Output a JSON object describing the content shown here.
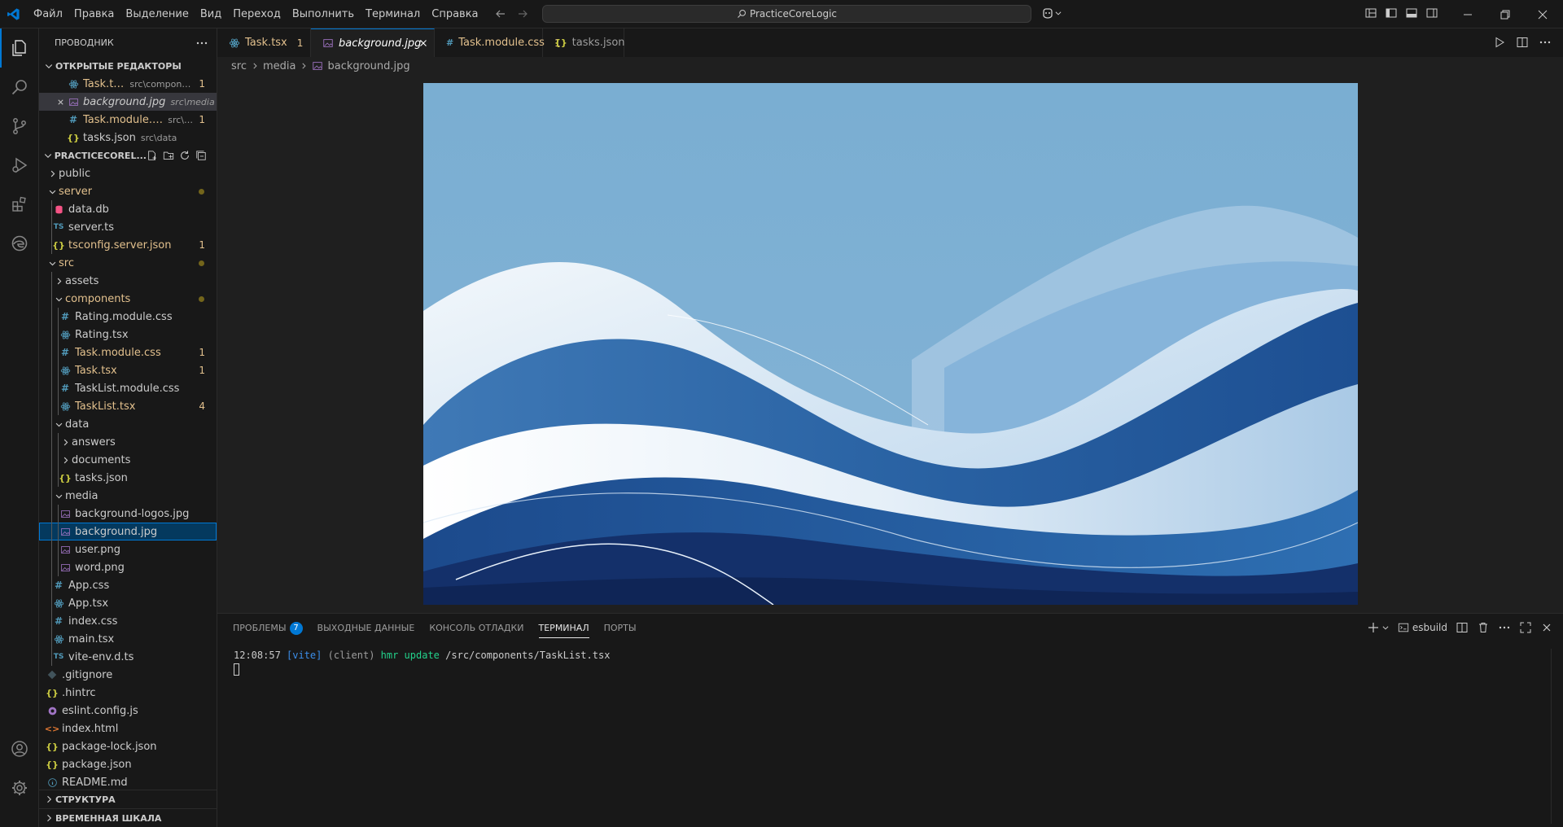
{
  "menu": [
    "Файл",
    "Правка",
    "Выделение",
    "Вид",
    "Переход",
    "Выполнить",
    "Терминал",
    "Справка"
  ],
  "command_center": "PracticeCoreLogic",
  "explorer": {
    "title": "ПРОВОДНИК",
    "open_editors_header": "ОТКРЫТЫЕ РЕДАКТОРЫ",
    "open_editors": [
      {
        "name": "Task.tsx",
        "path": "src\\compone...",
        "badge": "1",
        "icon": "react-icon"
      },
      {
        "name": "background.jpg",
        "path": "src\\media",
        "badge": "",
        "icon": "image-icon"
      },
      {
        "name": "Task.module.css",
        "path": "src\\c...",
        "badge": "1",
        "icon": "css-icon"
      },
      {
        "name": "tasks.json",
        "path": "src\\data",
        "badge": "",
        "icon": "json-icon"
      }
    ],
    "project_header": "PRACTICECOREL...",
    "tree": [
      {
        "name": "public",
        "type": "folder",
        "depth": 0,
        "expanded": false
      },
      {
        "name": "server",
        "type": "folder",
        "depth": 0,
        "expanded": true,
        "modified": true,
        "dot": true
      },
      {
        "name": "data.db",
        "type": "file",
        "depth": 1,
        "icon": "database-icon"
      },
      {
        "name": "server.ts",
        "type": "file",
        "depth": 1,
        "icon": "ts-icon"
      },
      {
        "name": "tsconfig.server.json",
        "type": "file",
        "depth": 1,
        "icon": "json-icon",
        "modified": true,
        "badge": "1"
      },
      {
        "name": "src",
        "type": "folder",
        "depth": 0,
        "expanded": true,
        "modified": true,
        "dot": true
      },
      {
        "name": "assets",
        "type": "folder",
        "depth": 1,
        "expanded": false
      },
      {
        "name": "components",
        "type": "folder",
        "depth": 1,
        "expanded": true,
        "modified": true,
        "dot": true
      },
      {
        "name": "Rating.module.css",
        "type": "file",
        "depth": 2,
        "icon": "css-icon"
      },
      {
        "name": "Rating.tsx",
        "type": "file",
        "depth": 2,
        "icon": "react-icon"
      },
      {
        "name": "Task.module.css",
        "type": "file",
        "depth": 2,
        "icon": "css-icon",
        "modified": true,
        "badge": "1"
      },
      {
        "name": "Task.tsx",
        "type": "file",
        "depth": 2,
        "icon": "react-icon",
        "modified": true,
        "badge": "1"
      },
      {
        "name": "TaskList.module.css",
        "type": "file",
        "depth": 2,
        "icon": "css-icon"
      },
      {
        "name": "TaskList.tsx",
        "type": "file",
        "depth": 2,
        "icon": "react-icon",
        "modified": true,
        "badge": "4"
      },
      {
        "name": "data",
        "type": "folder",
        "depth": 1,
        "expanded": true
      },
      {
        "name": "answers",
        "type": "folder",
        "depth": 2,
        "expanded": false
      },
      {
        "name": "documents",
        "type": "folder",
        "depth": 2,
        "expanded": false
      },
      {
        "name": "tasks.json",
        "type": "file",
        "depth": 2,
        "icon": "json-icon"
      },
      {
        "name": "media",
        "type": "folder",
        "depth": 1,
        "expanded": true
      },
      {
        "name": "background-logos.jpg",
        "type": "file",
        "depth": 2,
        "icon": "image-icon"
      },
      {
        "name": "background.jpg",
        "type": "file",
        "depth": 2,
        "icon": "image-icon",
        "selected": true
      },
      {
        "name": "user.png",
        "type": "file",
        "depth": 2,
        "icon": "image-icon"
      },
      {
        "name": "word.png",
        "type": "file",
        "depth": 2,
        "icon": "image-icon"
      },
      {
        "name": "App.css",
        "type": "file",
        "depth": 1,
        "icon": "css-icon"
      },
      {
        "name": "App.tsx",
        "type": "file",
        "depth": 1,
        "icon": "react-icon"
      },
      {
        "name": "index.css",
        "type": "file",
        "depth": 1,
        "icon": "css-icon"
      },
      {
        "name": "main.tsx",
        "type": "file",
        "depth": 1,
        "icon": "react-icon"
      },
      {
        "name": "vite-env.d.ts",
        "type": "file",
        "depth": 1,
        "icon": "ts-icon"
      },
      {
        "name": ".gitignore",
        "type": "file",
        "depth": 0,
        "icon": "git-icon"
      },
      {
        "name": ".hintrc",
        "type": "file",
        "depth": 0,
        "icon": "json-icon"
      },
      {
        "name": "eslint.config.js",
        "type": "file",
        "depth": 0,
        "icon": "eslint-icon"
      },
      {
        "name": "index.html",
        "type": "file",
        "depth": 0,
        "icon": "html-icon"
      },
      {
        "name": "package-lock.json",
        "type": "file",
        "depth": 0,
        "icon": "json-icon"
      },
      {
        "name": "package.json",
        "type": "file",
        "depth": 0,
        "icon": "json-icon"
      },
      {
        "name": "README.md",
        "type": "file",
        "depth": 0,
        "icon": "info-icon"
      }
    ],
    "outline_header": "СТРУКТУРА",
    "timeline_header": "ВРЕМЕННАЯ ШКАЛА"
  },
  "tabs": [
    {
      "name": "Task.tsx",
      "badge": "1"
    },
    {
      "name": "background.jpg",
      "badge": ""
    },
    {
      "name": "Task.module.css",
      "badge": "1"
    },
    {
      "name": "tasks.json",
      "badge": ""
    }
  ],
  "breadcrumb": [
    "src",
    "media",
    "background.jpg"
  ],
  "panel": {
    "tabs": {
      "problems": "ПРОБЛЕМЫ",
      "problems_count": "7",
      "output": "ВЫХОДНЫЕ ДАННЫЕ",
      "debug_console": "КОНСОЛЬ ОТЛАДКИ",
      "terminal": "ТЕРМИНАЛ",
      "ports": "ПОРТЫ"
    },
    "terminal_name": "esbuild",
    "log": {
      "time": "12:08:57",
      "tag": "[vite]",
      "client": "(client)",
      "action": "hmr update",
      "path": "/src/components/TaskList.tsx"
    }
  },
  "colors": {
    "accent": "#0078d4",
    "modified": "#e2c08d",
    "folder_dot": "#73651b",
    "css_icon": "#519aba",
    "react_icon": "#519aba",
    "ts_icon": "#519aba",
    "json_icon": "#cbcb41",
    "image_icon": "#a074c4",
    "db_icon": "#f55385",
    "git_icon": "#41535b",
    "eslint_icon": "#a074c4",
    "html_icon": "#e37933",
    "info_icon": "#519aba",
    "terminal_vite": "#3b8eea",
    "terminal_green": "#23d18b"
  }
}
